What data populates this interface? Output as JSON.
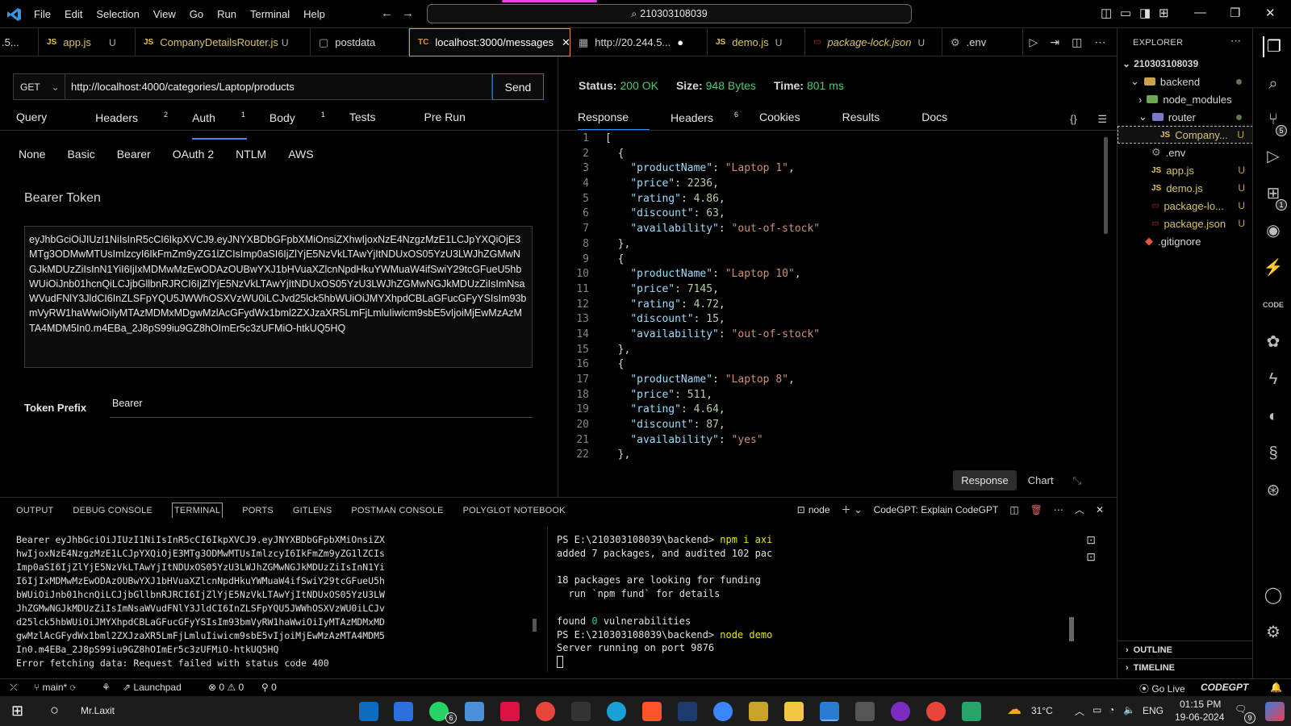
{
  "menubar": {
    "items": [
      "File",
      "Edit",
      "Selection",
      "View",
      "Go",
      "Run",
      "Terminal",
      "Help"
    ],
    "search": "210303108039"
  },
  "tabs": [
    {
      "label": ".5...",
      "icon": "",
      "status": ""
    },
    {
      "label": "app.js",
      "icon": "JS",
      "status": "U"
    },
    {
      "label": "CompanyDetailsRouter.js",
      "icon": "JS",
      "status": "U"
    },
    {
      "label": "postdata",
      "icon": "file-icon",
      "status": ""
    },
    {
      "label": "localhost:3000/messages",
      "icon": "TC",
      "status": ""
    },
    {
      "label": "http://20.244.5...",
      "icon": "globe-icon",
      "status": ""
    },
    {
      "label": "demo.js",
      "icon": "JS",
      "status": "U"
    },
    {
      "label": "package-lock.json",
      "icon": "json-icon",
      "status": "U"
    },
    {
      "label": ".env",
      "icon": "gear-icon",
      "status": ""
    }
  ],
  "request": {
    "method": "GET",
    "url": "http://localhost:4000/categories/Laptop/products",
    "send": "Send",
    "subtabs": [
      {
        "label": "Query",
        "count": ""
      },
      {
        "label": "Headers",
        "count": "2"
      },
      {
        "label": "Auth",
        "count": "1"
      },
      {
        "label": "Body",
        "count": "1"
      },
      {
        "label": "Tests",
        "count": ""
      },
      {
        "label": "Pre Run",
        "count": ""
      }
    ],
    "auth_types": [
      "None",
      "Basic",
      "Bearer",
      "OAuth 2",
      "NTLM",
      "AWS"
    ],
    "bearer_title": "Bearer Token",
    "token": "eyJhbGciOiJIUzI1NiIsInR5cCI6IkpXVCJ9.eyJNYXBDbGFpbXMiOnsiZXhwIjoxNzE4NzgzMzE1LCJpYXQiOjE3MTg3ODMwMTUsImlzcyI6IkFmZm9yZG1lZCIsImp0aSI6IjZlYjE5NzVkLTAwYjItNDUxOS05YzU3LWJhZGMwNGJkMDUzZiIsInN1YiI6IjIxMDMwMzEwODAzOUBwYXJ1bHVuaXZlcnNpdHkuYWMuaW4ifSwiY29tcGFueU5hbWUiOiJnb01hcnQiLCJjbGllbnRJRCI6IjZlYjE5NzVkLTAwYjItNDUxOS05YzU3LWJhZGMwNGJkMDUzZiIsImNsaWVudFNlY3JldCI6InZLSFpYQU5JWWhOSXVzWU0iLCJvd25lck5hbWUiOiJMYXhpdCBLaGFucGFyYSIsIm93bmVyRW1haWwiOiIyMTAzMDMxMDgwMzlAcGFydWx1bml2ZXJzaXR5LmFjLmluIiwicm9sbE5vIjoiMjEwMzAzMTA4MDM5In0.m4EBa_2J8pS99iu9GZ8hOImEr5c3zUFMiO-htkUQ5HQ",
    "prefix_label": "Token Prefix",
    "prefix_value": "Bearer"
  },
  "response": {
    "status_label": "Status:",
    "status_value": "200 OK",
    "size_label": "Size:",
    "size_value": "948 Bytes",
    "time_label": "Time:",
    "time_value": "801 ms",
    "tabs": [
      {
        "label": "Response",
        "count": ""
      },
      {
        "label": "Headers",
        "count": "6"
      },
      {
        "label": "Cookies",
        "count": ""
      },
      {
        "label": "Results",
        "count": ""
      },
      {
        "label": "Docs",
        "count": ""
      }
    ],
    "view_response": "Response",
    "view_chart": "Chart",
    "products": [
      {
        "productName": "Laptop 1",
        "price": 2236,
        "rating": 4.86,
        "discount": 63,
        "availability": "out-of-stock"
      },
      {
        "productName": "Laptop 10",
        "price": 7145,
        "rating": 4.72,
        "discount": 15,
        "availability": "out-of-stock"
      },
      {
        "productName": "Laptop 8",
        "price": 511,
        "rating": 4.64,
        "discount": 87,
        "availability": "yes"
      }
    ]
  },
  "explorer": {
    "title": "EXPLORER",
    "root": "210303108039",
    "items": [
      {
        "label": "backend",
        "type": "folder-open",
        "status": "dot"
      },
      {
        "label": "node_modules",
        "type": "folder-closed",
        "status": ""
      },
      {
        "label": "router",
        "type": "folder-open",
        "status": "dot"
      },
      {
        "label": "Company...",
        "type": "js",
        "status": "U"
      },
      {
        "label": ".env",
        "type": "gear",
        "status": ""
      },
      {
        "label": "app.js",
        "type": "js",
        "status": "U"
      },
      {
        "label": "demo.js",
        "type": "js",
        "status": "U"
      },
      {
        "label": "package-lo...",
        "type": "json",
        "status": "U"
      },
      {
        "label": "package.json",
        "type": "json",
        "status": "U"
      },
      {
        "label": ".gitignore",
        "type": "git",
        "status": ""
      }
    ],
    "outline": "OUTLINE",
    "timeline": "TIMELINE"
  },
  "panel": {
    "tabs": [
      "OUTPUT",
      "DEBUG CONSOLE",
      "TERMINAL",
      "PORTS",
      "GITLENS",
      "POSTMAN CONSOLE",
      "POLYGLOT NOTEBOOK"
    ],
    "terminal_name": "node",
    "codegpt_label": "CodeGPT: Explain CodeGPT",
    "left_lines": [
      "Bearer eyJhbGciOiJIUzI1NiIsInR5cCI6IkpXVCJ9.eyJNYXBDbGFpbXMiOnsiZX",
      "hwIjoxNzE4NzgzMzE1LCJpYXQiOjE3MTg3ODMwMTUsImlzcyI6IkFmZm9yZG1lZCIs",
      "Imp0aSI6IjZlYjE5NzVkLTAwYjItNDUxOS05YzU3LWJhZGMwNGJkMDUzZiIsInN1Yi",
      "I6IjIxMDMwMzEwODAzOUBwYXJ1bHVuaXZlcnNpdHkuYWMuaW4ifSwiY29tcGFueU5h",
      "bWUiOiJnb01hcnQiLCJjbGllbnRJRCI6IjZlYjE5NzVkLTAwYjItNDUxOS05YzU3LW",
      "JhZGMwNGJkMDUzZiIsImNsaWVudFNlY3JldCI6InZLSFpYQU5JWWhOSXVzWU0iLCJv",
      "d25lck5hbWUiOiJMYXhpdCBLaGFucGFyYSIsIm93bmVyRW1haWwiOiIyMTAzMDMxMD",
      "gwMzlAcGFydWx1bml2ZXJzaXR5LmFjLmluIiwicm9sbE5vIjoiMjEwMzAzMTA4MDM5",
      "In0.m4EBa_2J8pS99iu9GZ8hOImEr5c3zUFMiO-htkUQ5HQ",
      "Error fetching data: Request failed with status code 400"
    ],
    "right_lines": {
      "l1_prompt": "PS E:\\210303108039\\backend> ",
      "l1_cmd": "npm i axi",
      "l2": "added 7 packages, and audited 102 pac",
      "l3": "",
      "l4": "18 packages are looking for funding",
      "l5": "  run `npm fund` for details",
      "l6": "",
      "l7_a": "found ",
      "l7_b": "0",
      "l7_c": " vulnerabilities",
      "l8_prompt": "PS E:\\210303108039\\backend> ",
      "l8_cmd": "node demo",
      "l9": "Server running on port 9876"
    }
  },
  "statusbar": {
    "branch": "main*",
    "launchpad": "Launchpad",
    "errors": "0",
    "warnings": "0",
    "ports": "0",
    "golive": "Go Live",
    "codegpt": "CODEGPT"
  },
  "taskbar": {
    "user": "Mr.Laxit",
    "weather": "31°C",
    "lang": "ENG",
    "time": "01:15 PM",
    "date": "19-06-2024",
    "notif": "9",
    "whatsapp_badge": "6"
  },
  "colors": {
    "accent": "#3c8cf0",
    "status_ok": "#4ec96e",
    "tab_active_border": "#e8913b"
  }
}
